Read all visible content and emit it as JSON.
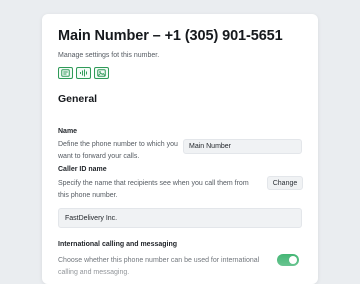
{
  "header": {
    "title": "Main Number – +1 (305) 901-5651",
    "subtitle": "Manage settings fot this number.",
    "icon_buttons": [
      {
        "name": "message-icon"
      },
      {
        "name": "voice-waveform-icon"
      },
      {
        "name": "image-icon"
      }
    ]
  },
  "general": {
    "section_title": "General",
    "name": {
      "label": "Name",
      "description": "Define the phone number to which you want to forward your calls.",
      "value": "Main Number"
    },
    "caller_id": {
      "label": "Caller ID name",
      "description": "Specify the name that recipients see when you call them from this phone number.",
      "change_label": "Change",
      "value": "FastDelivery Inc."
    },
    "international": {
      "label": "International calling and messaging",
      "description": "Choose whether this phone number can be used for international calling and messaging.",
      "enabled": true
    }
  },
  "colors": {
    "accent": "#35b06a",
    "icon_border": "#2f9a58"
  }
}
